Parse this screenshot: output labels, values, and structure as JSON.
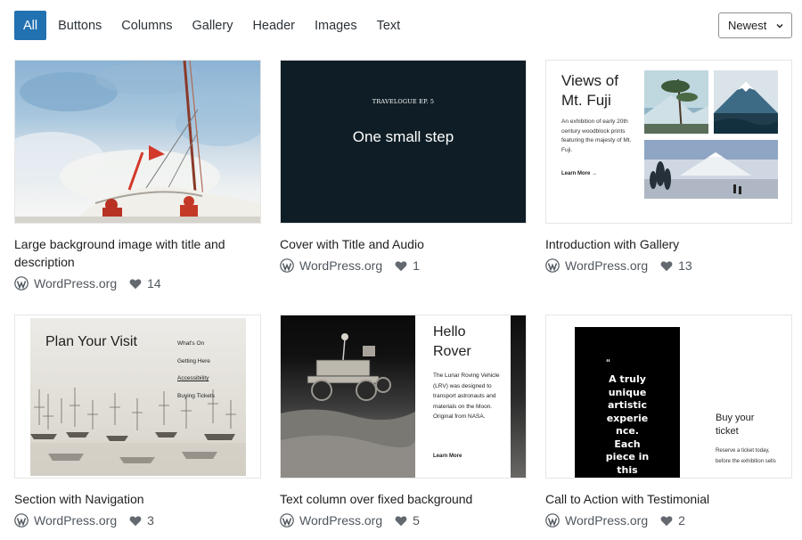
{
  "filters": {
    "tabs": [
      {
        "label": "All",
        "active": true
      },
      {
        "label": "Buttons"
      },
      {
        "label": "Columns"
      },
      {
        "label": "Gallery"
      },
      {
        "label": "Header"
      },
      {
        "label": "Images"
      },
      {
        "label": "Text"
      }
    ],
    "sort": {
      "selected": "Newest"
    }
  },
  "colors": {
    "accent": "#2271b1",
    "text": "#1e1e1e",
    "meta": "#50575e"
  },
  "patterns": [
    {
      "title": "Large background image with title and description",
      "author": "WordPress.org",
      "likes": "14"
    },
    {
      "title": "Cover with Title and Audio",
      "author": "WordPress.org",
      "likes": "1",
      "preview": {
        "kicker": "TRAVELOGUE EP. 5",
        "heading": "One small step"
      }
    },
    {
      "title": "Introduction with Gallery",
      "author": "WordPress.org",
      "likes": "13",
      "preview": {
        "heading": "Views of Mt. Fuji",
        "body": "An exhibition of early 20th century woodblock prints featuring the majesty of Mt. Fuji.",
        "link": "Learn More →"
      }
    },
    {
      "title": "Section with Navigation",
      "author": "WordPress.org",
      "likes": "3",
      "preview": {
        "heading": "Plan Your Visit",
        "nav": [
          "What's On",
          "Getting Here",
          "Accessibility",
          "Buying Tickets"
        ]
      }
    },
    {
      "title": "Text column over fixed background",
      "author": "WordPress.org",
      "likes": "5",
      "preview": {
        "heading": "Hello Rover",
        "body": "The Lunar Roving Vehicle (LRV) was designed to transport astronauts and materials on the Moon. Original from NASA.",
        "link": "Learn More"
      }
    },
    {
      "title": "Call to Action with Testimonial",
      "author": "WordPress.org",
      "likes": "2",
      "preview": {
        "quote_mark": "“",
        "quote": "A truly unique artistic experie nce. Each piece in this",
        "heading": "Buy your ticket",
        "body": "Reserve a ticket today, before the exhibition sells"
      }
    }
  ]
}
